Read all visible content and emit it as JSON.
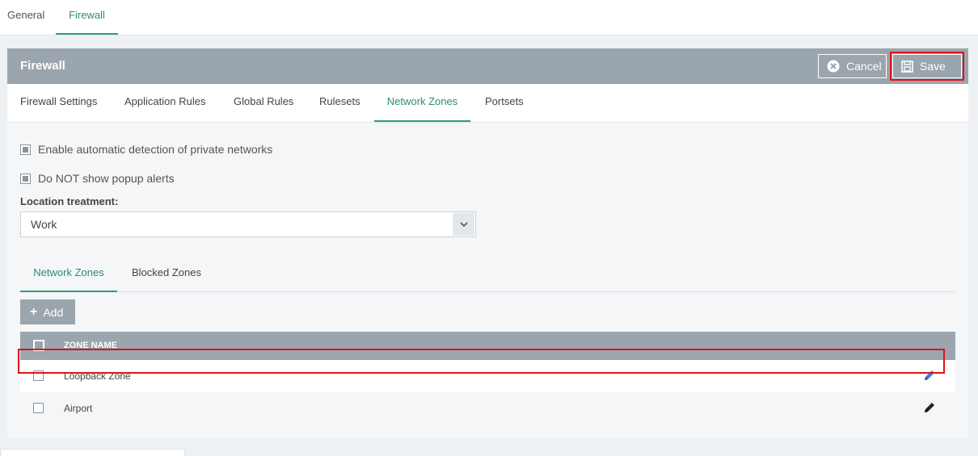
{
  "top_tabs": {
    "general": "General",
    "firewall": "Firewall"
  },
  "panel": {
    "title": "Firewall",
    "cancel_label": "Cancel",
    "save_label": "Save"
  },
  "sub_tabs": [
    "Firewall Settings",
    "Application Rules",
    "Global Rules",
    "Rulesets",
    "Network Zones",
    "Portsets"
  ],
  "options": {
    "auto_detect": "Enable automatic detection of private networks",
    "no_popup": "Do NOT show popup alerts"
  },
  "location": {
    "label": "Location treatment:",
    "value": "Work"
  },
  "inner_tabs": [
    "Network Zones",
    "Blocked Zones"
  ],
  "add_label": "Add",
  "table": {
    "header": "ZONE NAME",
    "rows": [
      {
        "name": "Loopback Zone"
      },
      {
        "name": "Airport"
      }
    ]
  },
  "colors": {
    "accent": "#2e9c7f",
    "header": "#9aa5ae",
    "highlight": "#e0121c",
    "edit_blue": "#3b7fd0"
  },
  "icons": {
    "cancel": "x-circle-icon",
    "save": "floppy-disk-icon",
    "dropdown": "chevron-down-icon",
    "add": "plus-icon",
    "edit": "pencil-icon"
  }
}
